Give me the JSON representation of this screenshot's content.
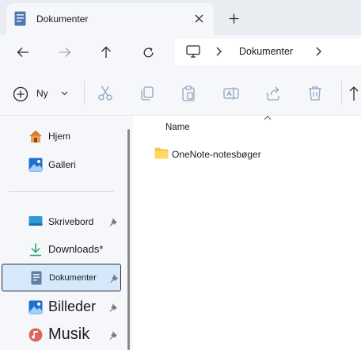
{
  "tab": {
    "title": "Dokumenter"
  },
  "address": {
    "segment": "Dokumenter"
  },
  "toolbar": {
    "new_label": "Ny"
  },
  "sidebar": {
    "items": [
      {
        "label": "Hjem"
      },
      {
        "label": "Galleri"
      },
      {
        "label": "Skrivebord"
      },
      {
        "label": "Downloads*"
      },
      {
        "label": "Dokumenter"
      },
      {
        "label": "Billeder"
      },
      {
        "label": "Musik"
      }
    ]
  },
  "content": {
    "column_name": "Name",
    "items": [
      {
        "label": "OneNote-notesbøger"
      }
    ]
  },
  "colors": {
    "accent": "#0067c0",
    "folder": "#f8c545",
    "selected": "#d6e8fb"
  }
}
